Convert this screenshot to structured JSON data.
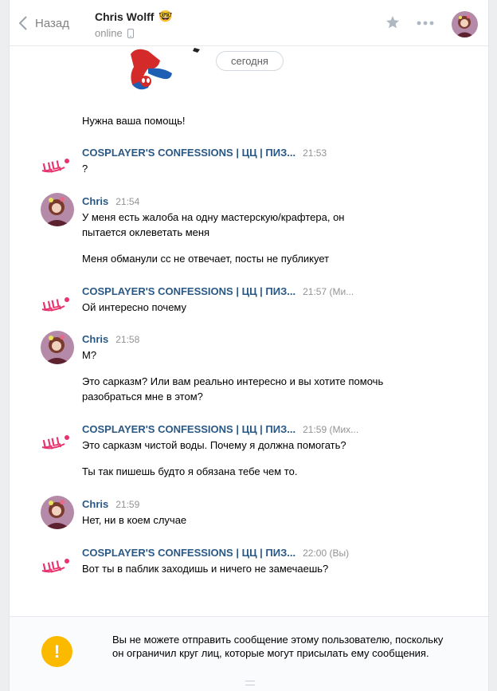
{
  "header": {
    "back_label": "Назад",
    "peer_name": "Chris Wolff",
    "peer_emoji": "🤓",
    "peer_status": "online"
  },
  "date_divider": "сегодня",
  "messages": [
    {
      "author": "",
      "time": "",
      "lines": [
        "Нужна ваша помощь!"
      ]
    },
    {
      "author": "COSPLAYER'S CONFESSIONS | ЦЦ | ПИЗ...",
      "time": "21:53",
      "lines": [
        "?"
      ]
    },
    {
      "author": "Chris",
      "time": "21:54",
      "lines": [
        "У меня есть жалоба на одну мастерскую/крафтера, он пытается оклеветать меня",
        "Меня обманули сс не отвечает, посты не публикует"
      ]
    },
    {
      "author": "COSPLAYER'S CONFESSIONS | ЦЦ | ПИЗ...",
      "time": "21:57 (Ми...",
      "lines": [
        "Ой интересно почему"
      ]
    },
    {
      "author": "Chris",
      "time": "21:58",
      "lines": [
        "М?",
        "Это сарказм? Или вам реально интересно и вы хотите помочь разобраться мне в этом?"
      ]
    },
    {
      "author": "COSPLAYER'S CONFESSIONS | ЦЦ | ПИЗ...",
      "time": "21:59 (Мих...",
      "lines": [
        "Это сарказм чистой воды. Почему я должна помогать?",
        "Ты так пишешь будто я обязана тебе чем то."
      ]
    },
    {
      "author": "Chris",
      "time": "21:59",
      "lines": [
        "Нет, ни в коем случае"
      ]
    },
    {
      "author": "COSPLAYER'S CONFESSIONS | ЦЦ | ПИЗ...",
      "time": "22:00 (Вы)",
      "lines": [
        "Вот ты в паблик заходишь и ничего не замечаешь?"
      ]
    }
  ],
  "footer": {
    "warning_icon": "!",
    "warning_text": "Вы не можете отправить сообщение этому пользователю, поскольку он ограничил круг лиц, которые могут присылать ему сообщения."
  },
  "colors": {
    "author": "#2a5885",
    "time": "#939393",
    "warning": "#fbb900"
  }
}
